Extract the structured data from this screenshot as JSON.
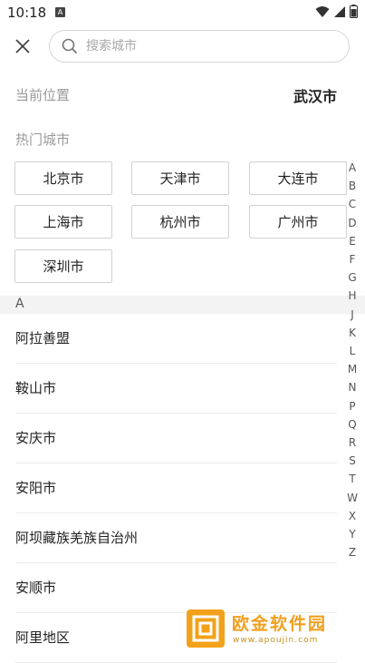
{
  "status_bar": {
    "time": "10:18",
    "notif_badge": "A"
  },
  "search": {
    "placeholder": "搜索城市"
  },
  "current_location": {
    "label": "当前位置",
    "city": "武汉市"
  },
  "hot_cities": {
    "label": "热门城市",
    "items": [
      "北京市",
      "天津市",
      "大连市",
      "上海市",
      "杭州市",
      "广州市",
      "深圳市"
    ]
  },
  "list_section": {
    "letter": "A",
    "items": [
      "阿拉善盟",
      "鞍山市",
      "安庆市",
      "安阳市",
      "阿坝藏族羌族自治州",
      "安顺市",
      "阿里地区"
    ]
  },
  "index_letters": [
    "A",
    "B",
    "C",
    "D",
    "E",
    "F",
    "G",
    "H",
    "J",
    "K",
    "L",
    "M",
    "N",
    "P",
    "Q",
    "R",
    "S",
    "T",
    "W",
    "X",
    "Y",
    "Z"
  ],
  "watermark": {
    "text": "欧金软件园",
    "url": "www.apoujin.com"
  },
  "colors": {
    "accent_watermark": "#f2a21a",
    "divider": "#ececec",
    "section_bg": "#f3f3f3"
  }
}
